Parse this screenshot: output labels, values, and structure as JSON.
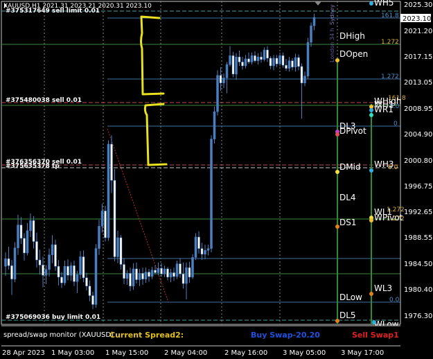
{
  "header": {
    "symbol_line": "XAUUSD,H1  2021.31  2023.21  2020.31  2023.10"
  },
  "price_axis": {
    "ticks": [
      "2025.30",
      "2021.20",
      "2017.15",
      "2013.05",
      "2008.95",
      "2004.90",
      "2000.80",
      "1996.75",
      "1992.65",
      "1988.55",
      "1984.50",
      "1980.40",
      "1976.30"
    ],
    "current_price": "2023.10",
    "colors": {
      "bg": "#000000",
      "grid": "#5a5a5a",
      "text": "#ffffff",
      "candle": "#4a7fc0"
    }
  },
  "time_axis": {
    "ticks": [
      "28 Apr 2023",
      "1 May 03:00",
      "1 May 15:00",
      "2 May 04:00",
      "2 May 16:00",
      "3 May 05:00",
      "3 May 17:00"
    ]
  },
  "orders": {
    "top": "#375317649 sell limit 0.01",
    "mid_sell": "#375480038 sell 0.01",
    "lower_sell": "#376356370 sell 0.01",
    "lower_sell_b": "#375635378 tp",
    "buy_limit": "#375069036 buy limit 0.01"
  },
  "levels": {
    "fib_top": "161.8",
    "fib_1272_a": "1.272",
    "fib_1272_b": "1.272",
    "fib_zero": "0",
    "fib_zero_b": "0.0",
    "fib_zero_c": "0.0",
    "fib_1618_side": "161.8",
    "fib_1272_side": "1.272",
    "fib_1272_side_b": "1.272",
    "fib_zero_wr": "0.0"
  },
  "pivots": {
    "dhigh": "DHigh",
    "dopen": "DOpen",
    "dl3": "DL3",
    "dpivot": "DPivot",
    "dmid": "DMid",
    "dl4": "DL4",
    "ds1": "DS1",
    "dlow": "DLow",
    "dl5": "DL5",
    "wh5": "WH5",
    "whigh": "WHigh",
    "wh1": "WH1",
    "wr1": "WR1",
    "wh3": "WH3",
    "wl1": "WL1",
    "wpivot": "WPivot",
    "wl3": "WL3",
    "wlow": "WLow"
  },
  "vertical_labels": {
    "symbol": "Sydney",
    "session": "London 34 h"
  },
  "bottom_panel": {
    "monitor": "spread/swap monitor (XAUUSD)",
    "spread": "Current Spread2:",
    "buy_swap": "Buy Swap-20.20",
    "sell_swap": "Sell Swap1"
  },
  "candles": [
    [
      2.0,
      1984.0,
      1986.2,
      1982.5,
      1985.2
    ],
    [
      6.5,
      1985.2,
      1987.1,
      1983.5,
      1984.1
    ],
    [
      11.0,
      1984.1,
      1985.0,
      1979.5,
      1982.0
    ],
    [
      15.5,
      1982.0,
      1987.8,
      1981.5,
      1986.9
    ],
    [
      20.0,
      1986.9,
      1992.1,
      1985.8,
      1990.5
    ],
    [
      24.5,
      1990.5,
      1991.7,
      1987.5,
      1988.4
    ],
    [
      29.0,
      1988.4,
      1989.2,
      1984.9,
      1986.1
    ],
    [
      33.5,
      1986.1,
      1990.8,
      1985.7,
      1989.6
    ],
    [
      38.0,
      1989.6,
      1992.3,
      1988.6,
      1991.2
    ],
    [
      42.5,
      1991.2,
      1991.9,
      1986.8,
      1987.9
    ],
    [
      47.0,
      1987.9,
      1989.3,
      1983.8,
      1985.0
    ],
    [
      51.5,
      1985.0,
      1986.6,
      1982.7,
      1984.2
    ],
    [
      56.0,
      1984.2,
      1985.5,
      1980.7,
      1982.6
    ],
    [
      60.5,
      1982.6,
      1984.2,
      1981.2,
      1983.5
    ],
    [
      65.0,
      1983.5,
      1986.8,
      1982.4,
      1985.8
    ],
    [
      69.5,
      1985.8,
      1988.9,
      1984.5,
      1987.4
    ],
    [
      74.0,
      1987.4,
      1988.2,
      1983.3,
      1984.0
    ],
    [
      78.5,
      1984.0,
      1985.0,
      1981.0,
      1982.3
    ],
    [
      83.0,
      1982.3,
      1983.1,
      1980.6,
      1981.4
    ],
    [
      87.5,
      1981.4,
      1984.9,
      1981.0,
      1984.0
    ],
    [
      92.0,
      1984.0,
      1985.1,
      1981.8,
      1982.6
    ],
    [
      96.5,
      1982.6,
      1984.6,
      1981.7,
      1984.1
    ],
    [
      101.0,
      1984.1,
      1984.9,
      1980.9,
      1981.6
    ],
    [
      105.5,
      1981.6,
      1983.3,
      1979.8,
      1982.7
    ],
    [
      110.0,
      1982.7,
      1986.4,
      1982.0,
      1985.5
    ],
    [
      114.5,
      1985.5,
      1986.5,
      1981.5,
      1982.2
    ],
    [
      119.0,
      1982.2,
      1983.0,
      1980.2,
      1980.9
    ],
    [
      123.5,
      1980.9,
      1981.8,
      1978.5,
      1979.4
    ],
    [
      128.0,
      1979.4,
      1980.0,
      1977.3,
      1978.0
    ],
    [
      132.5,
      1978.0,
      1987.5,
      1977.5,
      1986.8
    ],
    [
      137.0,
      1986.8,
      1991.3,
      1985.8,
      1990.3
    ],
    [
      141.5,
      1990.3,
      1993.8,
      1989.3,
      1992.7
    ],
    [
      146.0,
      1992.7,
      1993.5,
      1987.9,
      1988.5
    ],
    [
      150.5,
      1988.5,
      2003.8,
      1988.0,
      2003.2
    ],
    [
      155.0,
      2003.2,
      2004.6,
      1995.5,
      1997.5
    ],
    [
      159.5,
      1997.5,
      1999.3,
      1984.8,
      1985.5
    ],
    [
      164.0,
      1985.5,
      1989.6,
      1984.5,
      1988.5
    ],
    [
      168.5,
      1988.5,
      1988.9,
      1983.5,
      1984.3
    ],
    [
      173.0,
      1984.3,
      1985.3,
      1981.2,
      1982.1
    ],
    [
      177.5,
      1982.1,
      1983.4,
      1981.1,
      1982.9
    ],
    [
      182.0,
      1982.9,
      1983.8,
      1980.1,
      1980.9
    ],
    [
      186.5,
      1980.9,
      1984.5,
      1980.3,
      1983.6
    ],
    [
      191.0,
      1983.6,
      1984.6,
      1981.3,
      1981.9
    ],
    [
      195.5,
      1981.9,
      1983.6,
      1980.9,
      1982.9
    ],
    [
      200.0,
      1982.9,
      1983.8,
      1981.1,
      1982.0
    ],
    [
      204.5,
      1982.0,
      1983.8,
      1981.4,
      1983.1
    ],
    [
      209.0,
      1983.1,
      1983.6,
      1981.6,
      1982.4
    ],
    [
      213.5,
      1982.4,
      1983.9,
      1982.0,
      1983.4
    ],
    [
      218.0,
      1983.4,
      1984.2,
      1982.7,
      1983.0
    ],
    [
      222.5,
      1983.0,
      1984.6,
      1982.6,
      1983.7
    ],
    [
      227.0,
      1983.7,
      1984.5,
      1982.4,
      1982.8
    ],
    [
      231.5,
      1982.8,
      1984.1,
      1982.3,
      1983.6
    ],
    [
      236.0,
      1983.6,
      1983.9,
      1981.8,
      1982.3
    ],
    [
      240.5,
      1982.3,
      1983.6,
      1981.5,
      1983.0
    ],
    [
      245.0,
      1983.0,
      1983.8,
      1981.7,
      1982.4
    ],
    [
      249.5,
      1982.4,
      1984.9,
      1982.0,
      1984.4
    ],
    [
      254.0,
      1984.4,
      1985.3,
      1982.2,
      1982.8
    ],
    [
      258.5,
      1982.8,
      1984.6,
      1980.5,
      1981.3
    ],
    [
      263.0,
      1981.3,
      1984.6,
      1978.8,
      1983.8
    ],
    [
      267.5,
      1983.8,
      1984.7,
      1981.4,
      1982.3
    ],
    [
      272.0,
      1982.3,
      1985.9,
      1982.0,
      1985.4
    ],
    [
      276.5,
      1985.4,
      1989.2,
      1985.0,
      1988.6
    ],
    [
      281.0,
      1988.6,
      1989.5,
      1986.0,
      1986.8
    ],
    [
      285.5,
      1986.8,
      1987.7,
      1985.0,
      1985.9
    ],
    [
      290.0,
      1985.9,
      1987.4,
      1985.1,
      1986.5
    ],
    [
      294.5,
      1986.5,
      1987.4,
      1985.7,
      1986.8
    ],
    [
      299.0,
      1986.8,
      2004.6,
      1986.2,
      2004.0
    ],
    [
      303.5,
      2004.0,
      2009.1,
      2003.3,
      2008.3
    ],
    [
      308.0,
      2008.3,
      2014.8,
      2007.7,
      2014.0
    ],
    [
      312.5,
      2014.0,
      2015.3,
      2011.6,
      2012.8
    ],
    [
      317.0,
      2012.8,
      2014.3,
      2012.0,
      2013.6
    ],
    [
      321.5,
      2013.6,
      2016.1,
      2011.2,
      2015.7
    ],
    [
      326.0,
      2015.7,
      2018.6,
      2015.4,
      2017.1
    ],
    [
      330.5,
      2017.1,
      2017.7,
      2013.7,
      2014.2
    ],
    [
      335.0,
      2014.2,
      2017.5,
      2013.3,
      2016.9
    ],
    [
      339.5,
      2016.9,
      2017.9,
      2015.5,
      2016.1
    ],
    [
      344.0,
      2016.1,
      2016.9,
      2014.9,
      2015.5
    ],
    [
      348.5,
      2015.5,
      2017.2,
      2015.1,
      2016.6
    ],
    [
      353.0,
      2016.6,
      2017.6,
      2015.8,
      2016.1
    ],
    [
      357.5,
      2016.1,
      2017.6,
      2015.7,
      2017.1
    ],
    [
      362.0,
      2017.1,
      2017.8,
      2016.0,
      2016.3
    ],
    [
      366.5,
      2016.3,
      2017.5,
      2015.7,
      2016.9
    ],
    [
      371.0,
      2016.9,
      2017.7,
      2016.0,
      2016.5
    ],
    [
      375.5,
      2016.5,
      2018.4,
      2016.2,
      2018.0
    ],
    [
      380.0,
      2018.0,
      2018.6,
      2016.1,
      2016.7
    ],
    [
      384.5,
      2016.7,
      2017.0,
      2015.0,
      2015.5
    ],
    [
      389.0,
      2015.5,
      2017.2,
      2014.8,
      2016.7
    ],
    [
      393.5,
      2016.7,
      2017.2,
      2015.3,
      2015.8
    ],
    [
      398.0,
      2015.8,
      2017.6,
      2015.4,
      2017.1
    ],
    [
      402.5,
      2017.1,
      2017.6,
      2015.2,
      2015.6
    ],
    [
      407.0,
      2015.6,
      2016.6,
      2014.7,
      2015.1
    ],
    [
      411.5,
      2015.1,
      2016.9,
      2014.6,
      2016.3
    ],
    [
      416.0,
      2016.3,
      2016.7,
      2014.8,
      2015.3
    ],
    [
      420.5,
      2015.3,
      2017.4,
      2014.6,
      2016.8
    ],
    [
      425.0,
      2016.8,
      2017.3,
      2014.8,
      2015.4
    ],
    [
      429.5,
      2015.4,
      2015.9,
      2007.2,
      2012.8
    ],
    [
      434.0,
      2012.8,
      2014.6,
      2012.3,
      2013.9
    ],
    [
      438.5,
      2013.9,
      2019.9,
      2013.4,
      2019.2
    ],
    [
      443.0,
      2019.2,
      2022.3,
      2018.5,
      2021.8
    ],
    [
      447.5,
      2021.8,
      2023.7,
      2021.1,
      2023.1
    ]
  ]
}
